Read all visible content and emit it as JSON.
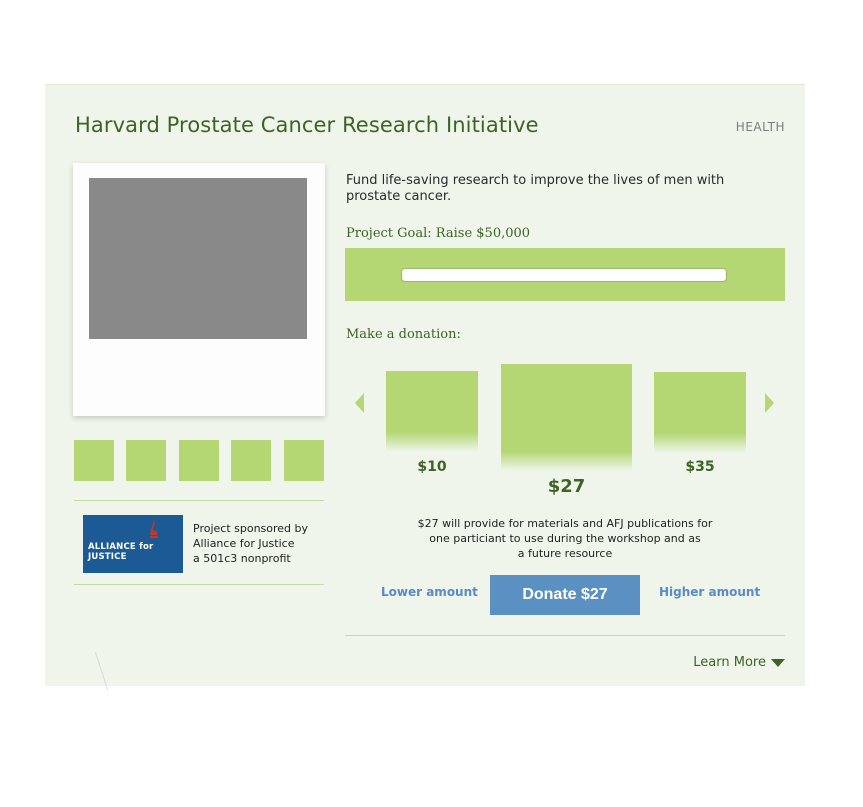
{
  "project": {
    "title": "Harvard Prostate Cancer Research Initiative",
    "category": "HEALTH",
    "description": "Fund life-saving research to improve the lives of men with prostate cancer.",
    "goal_label": "Project Goal: Raise $50,000",
    "progress_fraction": 0.0
  },
  "sponsor": {
    "logo_text": "ALLIANCE for JUSTICE",
    "line1": "Project sponsored by",
    "line2": "Alliance for Justice",
    "line3": "a 501c3 nonprofit"
  },
  "donation": {
    "heading": "Make a donation:",
    "options": [
      {
        "label": "$10"
      },
      {
        "label": "$27"
      },
      {
        "label": "$35"
      }
    ],
    "impact_line1": "$27 will provide for materials and AFJ publications for",
    "impact_line2": "one particiant to use during the workshop and as",
    "impact_line3": "a future resource",
    "lower_label": "Lower amount",
    "donate_label": "Donate $27",
    "higher_label": "Higher amount"
  },
  "footer": {
    "learn_more": "Learn More"
  },
  "colors": {
    "accent_green": "#b4d673",
    "text_green": "#3d6424",
    "button_blue": "#5a90c2",
    "card_bg": "#eff5eb"
  },
  "icons": [
    "chevron-left-icon",
    "chevron-right-icon",
    "caret-down-icon",
    "flame-icon"
  ]
}
